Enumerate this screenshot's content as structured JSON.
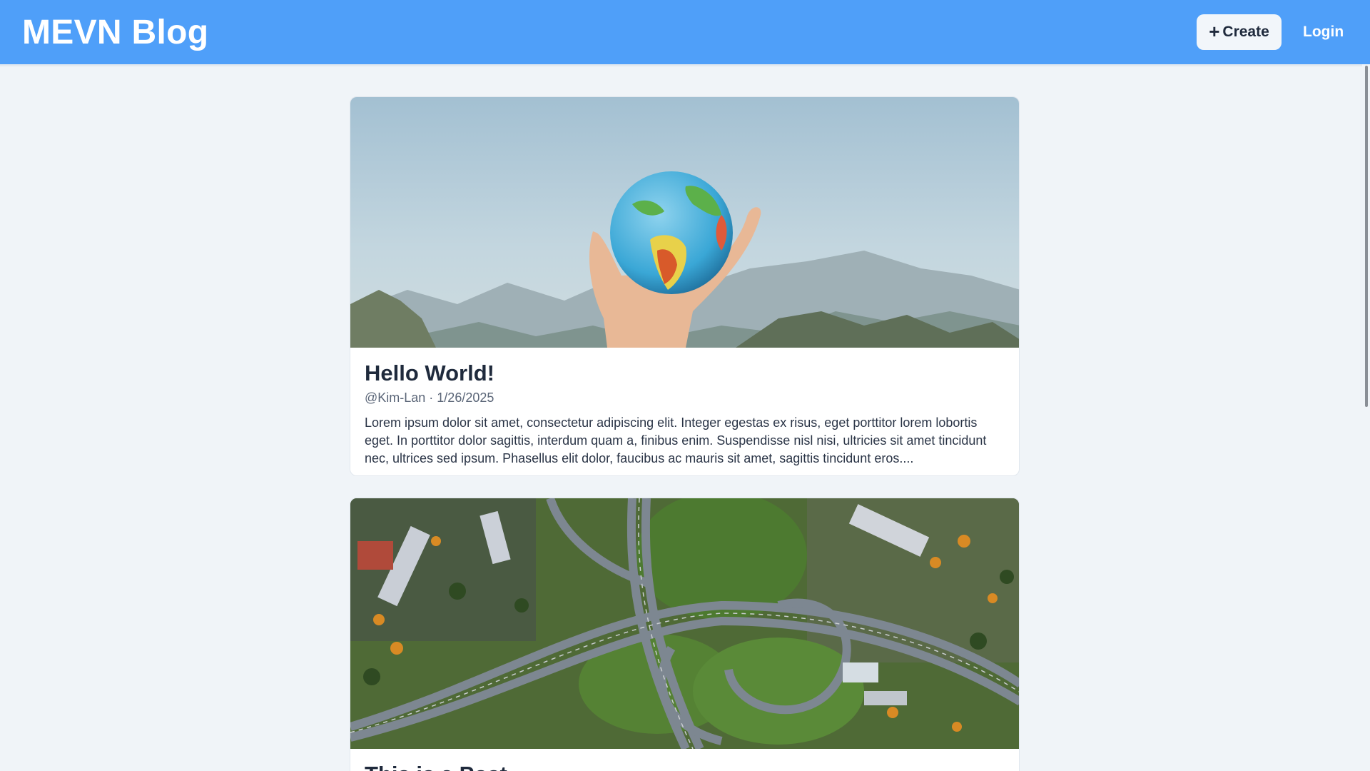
{
  "header": {
    "brand": "MEVN Blog",
    "create_label": "Create",
    "login_label": "Login"
  },
  "posts": [
    {
      "title": "Hello World!",
      "meta": "@Kim-Lan · 1/26/2025",
      "excerpt": "Lorem ipsum dolor sit amet, consectetur adipiscing elit. Integer egestas ex risus, eget porttitor lorem lobortis eget. In porttitor dolor sagittis, interdum quam a, finibus enim. Suspendisse nisl nisi, ultricies sit amet tincidunt nec, ultrices sed ipsum. Phasellus elit dolor, faucibus ac mauris sit amet, sagittis tincidunt eros....",
      "image_icon": "globe-in-hand-photo"
    },
    {
      "title": "This is a Post",
      "image_icon": "aerial-highway-interchange-photo"
    }
  ],
  "colors": {
    "navbar": "#4f9ff9",
    "page_bg": "#f0f4f8",
    "card_bg": "#ffffff",
    "text": "#1f2a3c",
    "muted": "#5a6577"
  }
}
